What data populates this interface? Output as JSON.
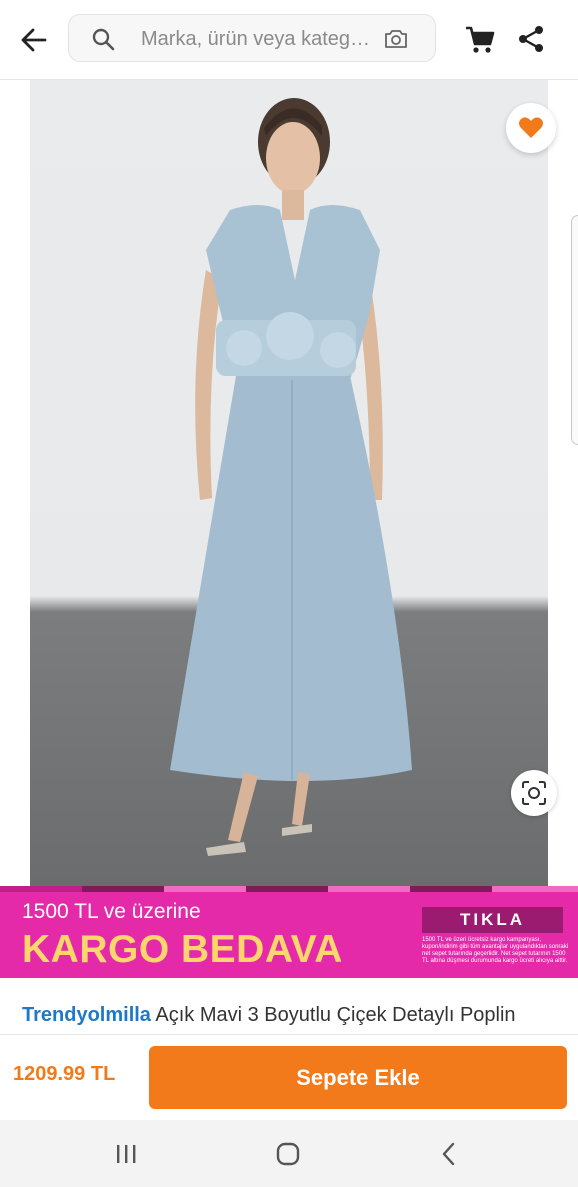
{
  "header": {
    "back_icon": "arrow-left-icon",
    "search": {
      "placeholder": "Marka, ürün veya kategori ara",
      "icon": "search-icon",
      "camera_icon": "camera-search-icon"
    },
    "cart_icon": "cart-icon",
    "share_icon": "share-icon"
  },
  "gallery": {
    "favorite_icon": "heart-icon",
    "favorite_color": "#f27a1a",
    "visual_search_icon": "lens-icon",
    "image_count": 5,
    "active_index": 0
  },
  "banner": {
    "line1": "1500 TL ve üzerine",
    "line2": "KARGO BEDAVA",
    "button": "TIKLA",
    "fine_print": "1500 TL ve üzeri ücretsiz kargo kampanyası, kupon/indirim gibi tüm avantajlar uygulandıktan sonraki net sepet tutarında geçerlidir. Net sepet tutarının 1500 TL altına düşmesi durumunda kargo ücreti alıcıya aittir.",
    "background": "#e42aa8",
    "accent": "#ffd66b"
  },
  "product": {
    "brand": "Trendyolmilla",
    "name": "Açık Mavi 3 Boyutlu Çiçek Detaylı Poplin"
  },
  "purchase": {
    "price": "1209.99 TL",
    "add_to_cart": "Sepete Ekle",
    "accent": "#f27a1a"
  },
  "system_nav": {
    "recents_icon": "recents-icon",
    "home_icon": "home-icon",
    "back_icon": "back-chevron-icon"
  }
}
